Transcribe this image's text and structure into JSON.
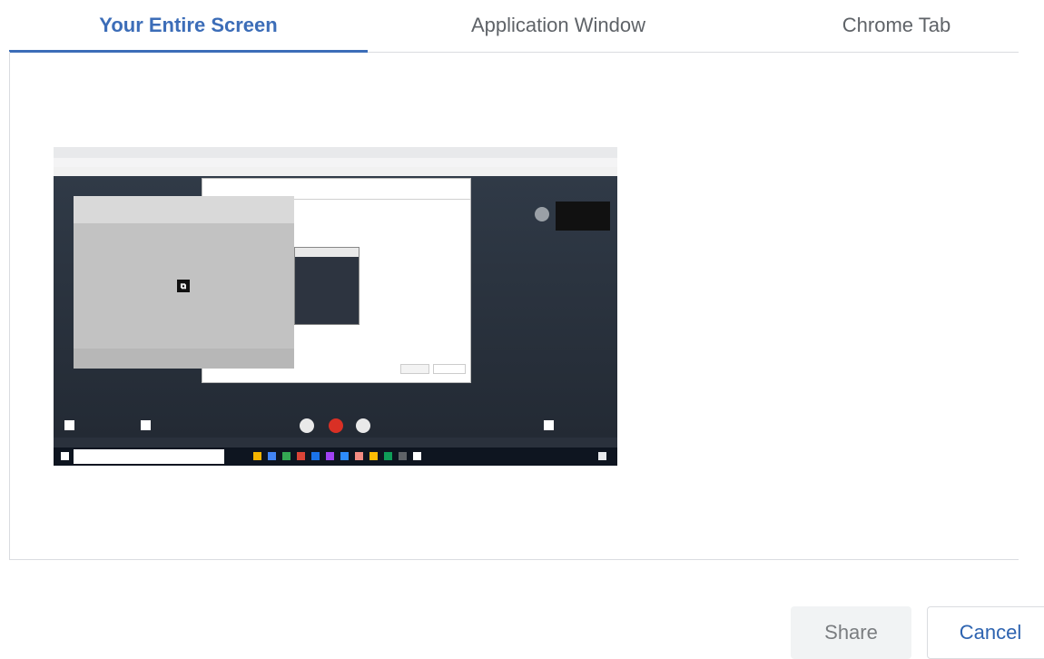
{
  "tabs": [
    {
      "label": "Your Entire Screen",
      "active": true
    },
    {
      "label": "Application Window",
      "active": false
    },
    {
      "label": "Chrome Tab",
      "active": false
    }
  ],
  "buttons": {
    "share_label": "Share",
    "cancel_label": "Cancel"
  },
  "colors": {
    "accent": "#3c6db8",
    "share_disabled_bg": "#f1f3f4",
    "cancel_text": "#2d63b0"
  }
}
